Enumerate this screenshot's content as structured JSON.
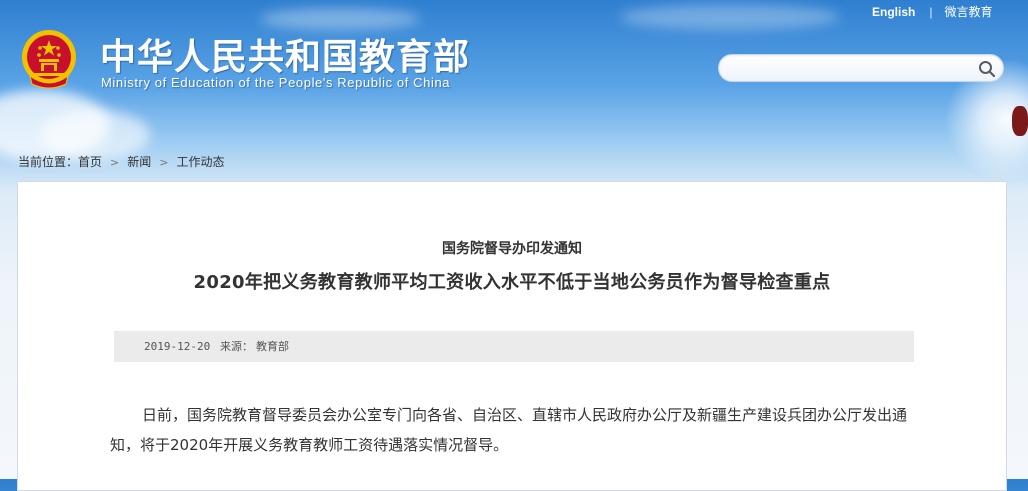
{
  "header": {
    "title_cn": "中华人民共和国教育部",
    "title_en": "Ministry of Education of the People's Republic of China",
    "links": {
      "english": "English",
      "separator": "|",
      "weibo": "微言教育"
    },
    "search": {
      "value": "",
      "placeholder": ""
    }
  },
  "breadcrumb": {
    "prefix": "当前位置：",
    "items": [
      "首页",
      "新闻",
      "工作动态"
    ],
    "separator": ">"
  },
  "article": {
    "subtitle": "国务院督导办印发通知",
    "title": "2020年把义务教育教师平均工资收入水平不低于当地公务员作为督导检查重点",
    "date": "2019-12-20",
    "source_label": "来源：",
    "source": "教育部",
    "paragraph_1": "日前，国务院教育督导委员会办公室专门向各省、自治区、直辖市人民政府办公厅及新疆生产建设兵团办公厅发出通知，将于2020年开展义务教育教师工资待遇落实情况督导。"
  },
  "colors": {
    "sky_top": "#2f7fd0",
    "emblem_red": "#c8102e",
    "emblem_gold": "#f2c200",
    "text": "#333333",
    "meta_bar": "#ebebeb"
  },
  "icons": {
    "search": "search-icon",
    "emblem": "national-emblem-icon"
  }
}
